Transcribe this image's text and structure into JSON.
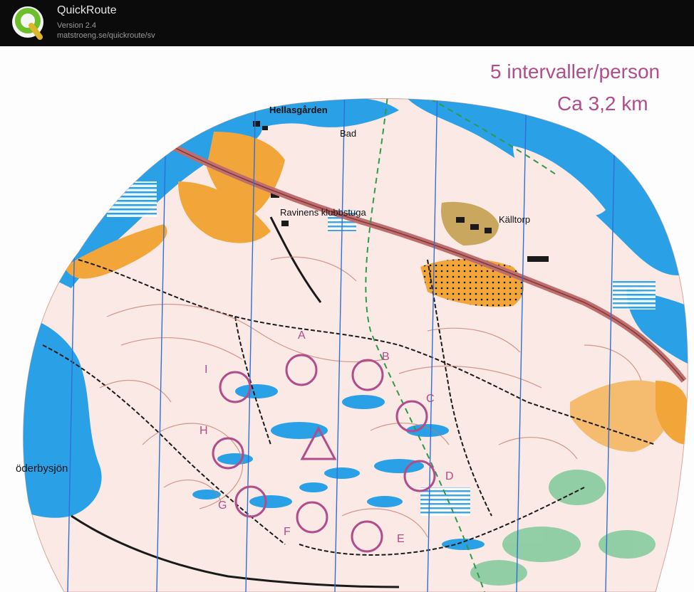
{
  "app": {
    "name": "QuickRoute",
    "version": "Version 2.4",
    "url": "matstroeng.se/quickroute/sv"
  },
  "map": {
    "place_labels": {
      "hellasgarden": "Hellasgården",
      "bad": "Bad",
      "ravinens": "Ravinens klubbstuga",
      "kalltorp": "Källtorp",
      "soderbysjon": "öderbysjön"
    },
    "annotation": {
      "line1": "5 intervaller/person",
      "line2": "Ca 3,2 km"
    },
    "controls": [
      {
        "letter": "A"
      },
      {
        "letter": "B"
      },
      {
        "letter": "C"
      },
      {
        "letter": "D"
      },
      {
        "letter": "E"
      },
      {
        "letter": "F"
      },
      {
        "letter": "G"
      },
      {
        "letter": "H"
      },
      {
        "letter": "I"
      }
    ],
    "colors": {
      "water": "#2aa0e6",
      "open_land": "#f2a63a",
      "road": "#c06d6d",
      "contour": "#c77b6a",
      "course": "#b04d8a",
      "terrain": "#fbe9e6",
      "north_lines": "#2f6fd6",
      "green": "#7fc99a"
    }
  }
}
